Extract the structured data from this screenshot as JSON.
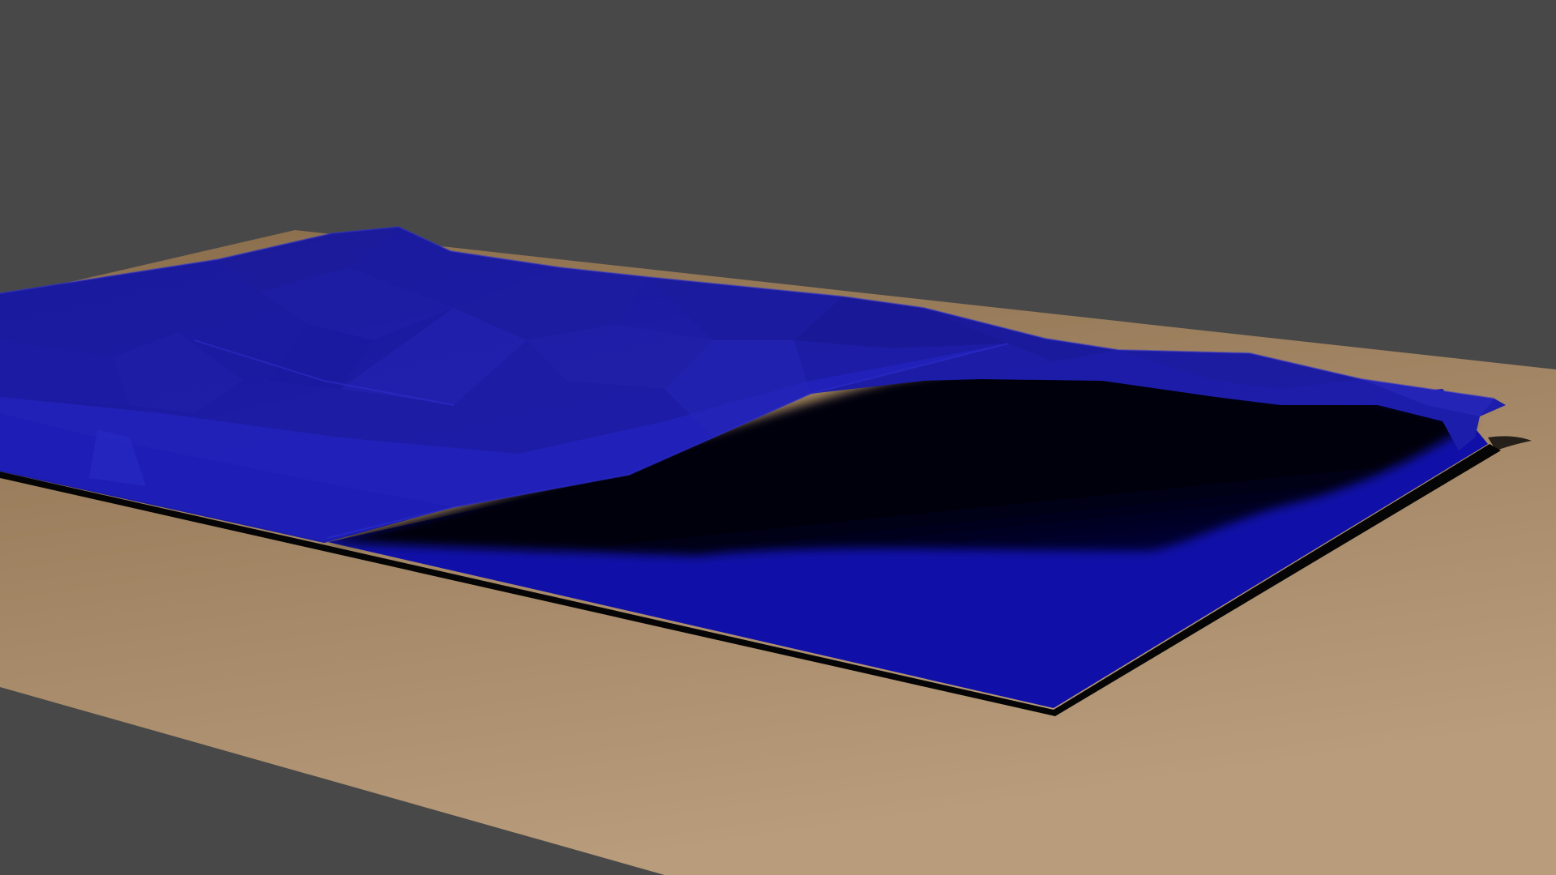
{
  "scene": {
    "background_color": "#484848",
    "table_colors": {
      "far": "#8a6e4c",
      "near": "#b89c7c"
    },
    "cloth_colors": {
      "base": "#1414b4",
      "flat": "#1010a8",
      "lit": "#2323bc",
      "top": "#1c1ca4",
      "shadow": "#000010",
      "edge_shadow": "#050505"
    }
  }
}
